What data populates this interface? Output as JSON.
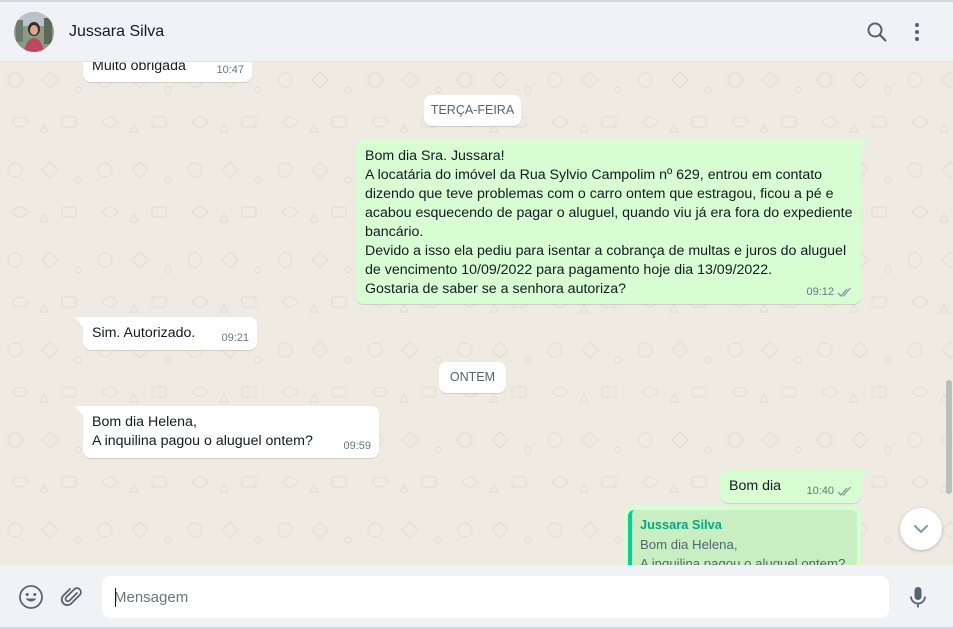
{
  "header": {
    "contact_name": "Jussara Silva",
    "icons": [
      "search-icon",
      "menu-icon"
    ]
  },
  "chat": {
    "messages": [
      {
        "direction": "in",
        "text": "Muito obrigada",
        "time": "10:47"
      },
      {
        "type": "date",
        "label": "TERÇA-FEIRA"
      },
      {
        "direction": "out",
        "text": "Bom dia Sra. Jussara!\nA locatária do imóvel da Rua Sylvio Campolim nº 629, entrou em contato\ndizendo que teve problemas com o carro ontem que estragou, ficou a pé e\nacabou esquecendo de pagar o aluguel, quando viu já era fora do expediente\nbancário.\nDevido a isso ela pediu para isentar a cobrança de multas e juros do aluguel\nde vencimento 10/09/2022 para pagamento hoje dia 13/09/2022.\nGostaria de saber se a senhora autoriza?",
        "time": "09:12",
        "status": "read"
      },
      {
        "direction": "in",
        "text": "Sim. Autorizado.",
        "time": "09:21"
      },
      {
        "type": "date",
        "label": "ONTEM"
      },
      {
        "direction": "in",
        "text": "Bom dia Helena,\nA inquilina pagou o aluguel ontem?",
        "time": "09:59"
      },
      {
        "direction": "out",
        "text": "Bom dia",
        "time": "10:40",
        "status": "read"
      },
      {
        "direction": "out",
        "reply_to": {
          "author": "Jussara Silva",
          "text": "Bom dia Helena,\nA inquilina pagou o aluguel ontem?"
        }
      }
    ]
  },
  "composer": {
    "placeholder": "Mensagem",
    "value": "",
    "icons": [
      "emoji-icon",
      "attach-icon",
      "microphone-icon"
    ]
  },
  "colors": {
    "incoming": "#ffffff",
    "outgoing": "#d9fdd3",
    "background": "#efeae2",
    "header": "#f0f2f5",
    "accent": "#06cf9c"
  }
}
